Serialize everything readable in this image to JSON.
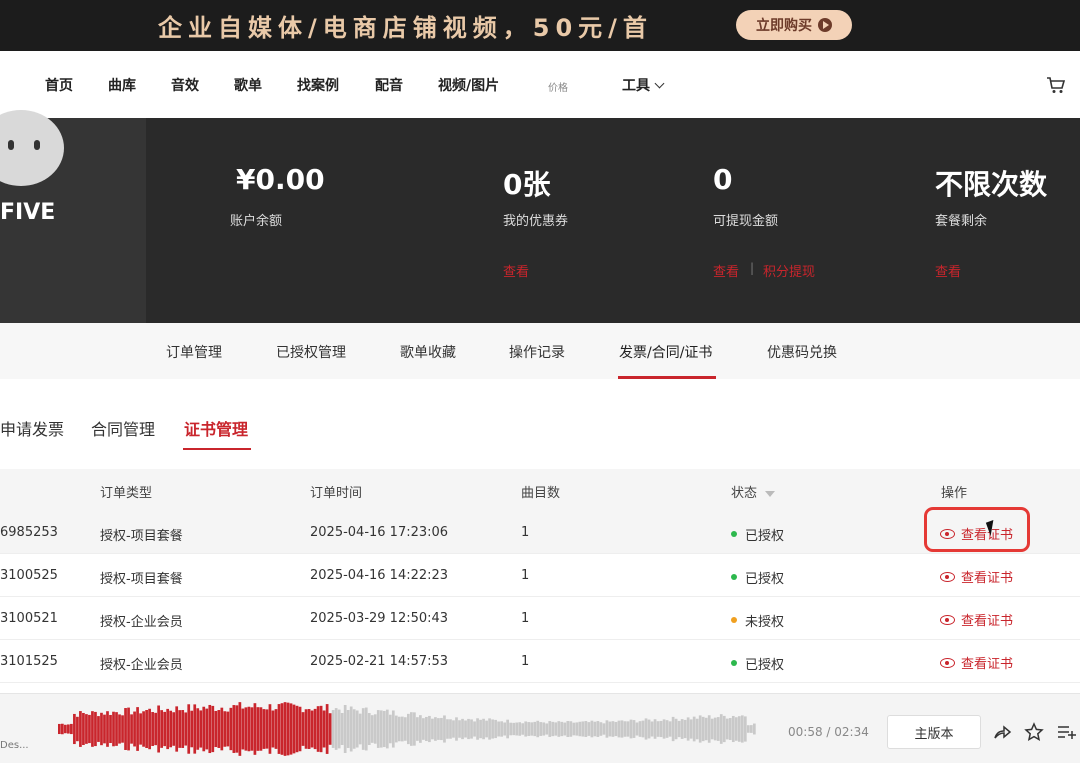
{
  "banner": {
    "text": "企业自媒体/电商店铺视频，50元/首",
    "button_label": "立即购买"
  },
  "nav": {
    "items": [
      "首页",
      "曲库",
      "音效",
      "歌单",
      "找案例",
      "配音",
      "视频/图片"
    ],
    "price_label": "价格",
    "tools_label": "工具"
  },
  "profile": {
    "username": "FIVE",
    "stats": [
      {
        "value": "¥0.00",
        "label": "账户余额"
      },
      {
        "value": "0张",
        "label": "我的优惠券",
        "link": "查看"
      },
      {
        "value": "0",
        "label": "可提现金额",
        "link": "查看",
        "link2": "积分提现"
      },
      {
        "value": "不限次数",
        "label": "套餐剩余",
        "link": "查看"
      }
    ]
  },
  "tabs": [
    "订单管理",
    "已授权管理",
    "歌单收藏",
    "操作记录",
    "发票/合同/证书",
    "优惠码兑换"
  ],
  "active_tab": "发票/合同/证书",
  "subtabs": [
    "申请发票",
    "合同管理",
    "证书管理"
  ],
  "active_subtab": "证书管理",
  "table": {
    "headers": [
      "订单类型",
      "订单时间",
      "曲目数",
      "状态",
      "操作"
    ],
    "rows": [
      {
        "id": "6985253",
        "type": "授权-项目套餐",
        "time": "2025-04-16 17:23:06",
        "count": "1",
        "status": "已授权",
        "status_color": "#2db84d",
        "action": "查看证书"
      },
      {
        "id": "3100525",
        "type": "授权-项目套餐",
        "time": "2025-04-16 14:22:23",
        "count": "1",
        "status": "已授权",
        "status_color": "#2db84d",
        "action": "查看证书"
      },
      {
        "id": "3100521",
        "type": "授权-企业会员",
        "time": "2025-03-29 12:50:43",
        "count": "1",
        "status": "未授权",
        "status_color": "#f0a020",
        "action": "查看证书"
      },
      {
        "id": "3101525",
        "type": "授权-企业会员",
        "time": "2025-02-21 14:57:53",
        "count": "1",
        "status": "已授权",
        "status_color": "#2db84d",
        "action": "查看证书"
      }
    ]
  },
  "player": {
    "title": "Des...",
    "time": "00:58 / 02:34",
    "version_label": "主版本",
    "progress": 0.39
  },
  "colors": {
    "accent": "#c9252c"
  }
}
